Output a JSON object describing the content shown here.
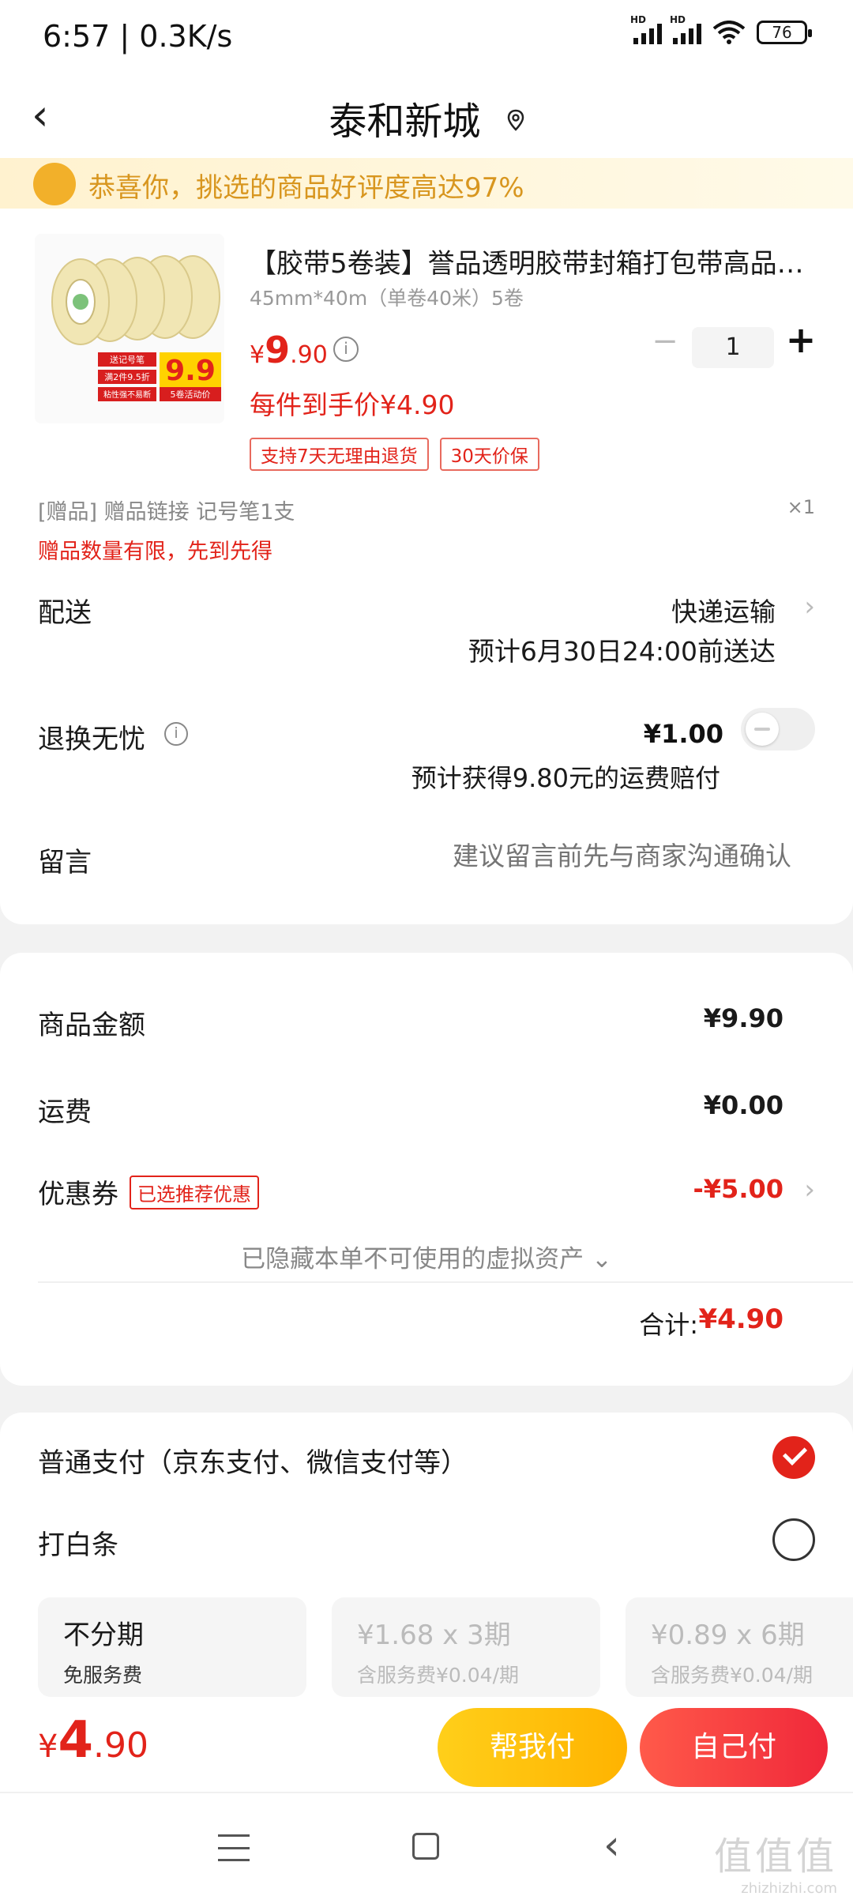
{
  "status_bar": {
    "time": "6:57 | 0.3K/s",
    "battery": "76"
  },
  "header": {
    "title": "泰和新城"
  },
  "banner": {
    "text": "恭喜你，挑选的商品好评度高达97%"
  },
  "product": {
    "name": "【胶带5卷装】誉品透明胶带封箱打包带高品…",
    "spec": "45mm*40m（单卷40米）5卷",
    "price_symbol": "¥",
    "price_int": "9",
    "price_dec": ".90",
    "quantity": "1",
    "final_price": "每件到手价¥4.90",
    "tags": [
      "支持7天无理由退货",
      "30天价保"
    ],
    "image_badge": "9.9",
    "image_badge_caption": "5卷活动价",
    "image_labels": [
      "送记号笔",
      "满2件9.5折",
      "粘性强不易断"
    ]
  },
  "gift": {
    "text": "[赠品]   赠品链接 记号笔1支",
    "qty": "×1",
    "note": "赠品数量有限，先到先得"
  },
  "delivery": {
    "label": "配送",
    "method": "快递运输",
    "eta": "预计6月30日24:00前送达"
  },
  "return_service": {
    "label": "退换无忧",
    "price": "¥1.00",
    "note": "预计获得9.80元的运费赔付",
    "enabled": false
  },
  "message": {
    "label": "留言",
    "placeholder": "建议留言前先与商家沟通确认"
  },
  "summary": {
    "goods_label": "商品金额",
    "goods_value": "¥9.90",
    "shipping_label": "运费",
    "shipping_value": "¥0.00",
    "coupon_label": "优惠券",
    "coupon_tag": "已选推荐优惠",
    "coupon_value": "-¥5.00",
    "hidden_assets": "已隐藏本单不可使用的虚拟资产",
    "total_label": "合计:",
    "total_value": "¥4.90"
  },
  "payment": {
    "normal_label": "普通支付（京东支付、微信支付等）",
    "baitiao_label": "打白条",
    "plans": [
      {
        "title": "不分期",
        "sub": "免服务费"
      },
      {
        "title": "¥1.68 x 3期",
        "sub": "含服务费¥0.04/期"
      },
      {
        "title": "¥0.89 x 6期",
        "sub": "含服务费¥0.04/期"
      }
    ]
  },
  "bottom_bar": {
    "symbol": "¥",
    "amount_int": "4",
    "amount_dec": ".90",
    "friend_pay": "帮我付",
    "self_pay": "自己付"
  },
  "watermark": {
    "line1": "值值值",
    "line2": "zhizhizhi.com"
  },
  "colors": {
    "accent_red": "#e2231a",
    "friend_button": "#ffb300",
    "banner_text": "#d8961f"
  }
}
